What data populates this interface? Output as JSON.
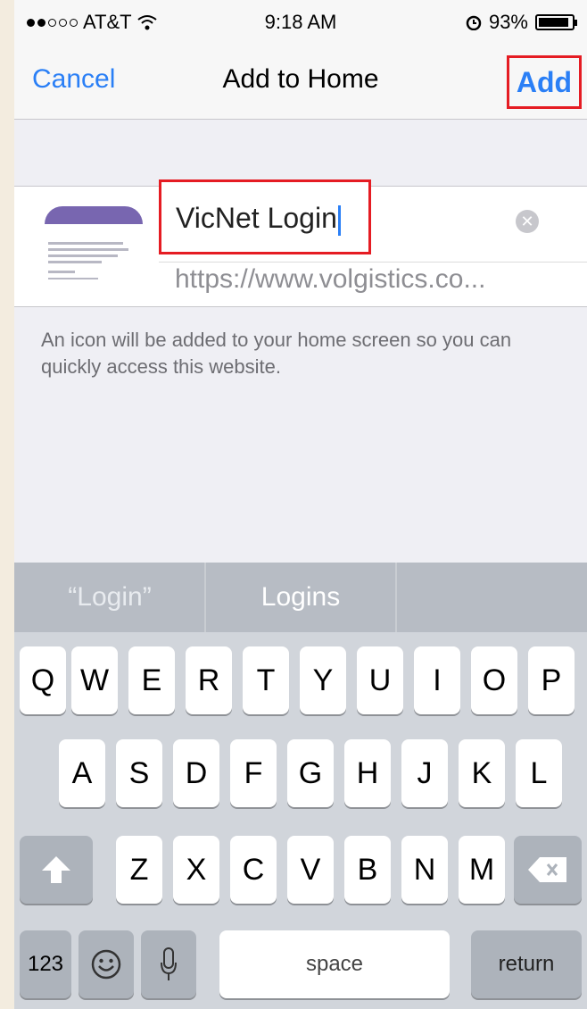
{
  "status_bar": {
    "carrier": "AT&T",
    "time": "9:18 AM",
    "battery": "93%",
    "battery_level": 0.93
  },
  "nav": {
    "cancel": "Cancel",
    "title": "Add to Home",
    "add": "Add"
  },
  "form": {
    "name_value": "VicNet Login",
    "url": "https://www.volgistics.co..."
  },
  "help_text": "An icon will be added to your home screen so you can quickly access this website.",
  "suggestions": [
    "“Login”",
    "Logins",
    ""
  ],
  "keyboard": {
    "row1": [
      "Q",
      "W",
      "E",
      "R",
      "T",
      "Y",
      "U",
      "I",
      "O",
      "P"
    ],
    "row2": [
      "A",
      "S",
      "D",
      "F",
      "G",
      "H",
      "J",
      "K",
      "L"
    ],
    "row3": [
      "Z",
      "X",
      "C",
      "V",
      "B",
      "N",
      "M"
    ],
    "numbers": "123",
    "space": "space",
    "return": "return"
  },
  "colors": {
    "accent": "#2a7ff6",
    "highlight": "#e51c23"
  }
}
